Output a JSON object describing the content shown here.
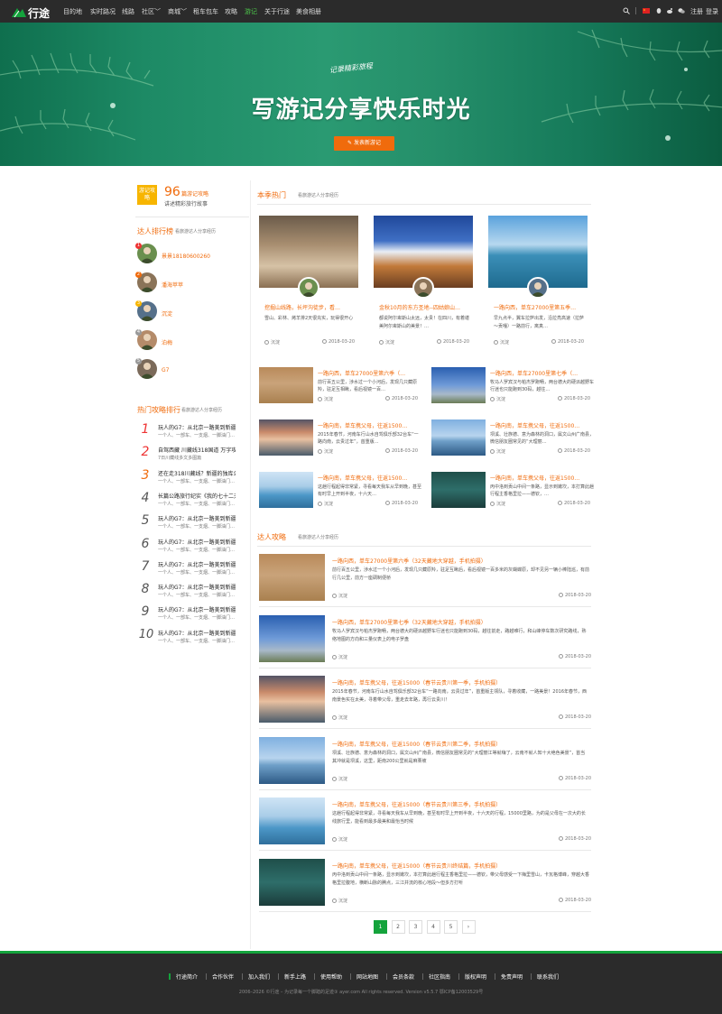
{
  "brand": {
    "logo_text": "行途",
    "accent": "#14a33c",
    "orange": "#f06b0c"
  },
  "nav": {
    "items": [
      "目的地",
      "实时路况",
      "线路",
      "社区",
      "商城",
      "租车包车",
      "攻略",
      "游记",
      "关于行途",
      "美食相册"
    ],
    "active": "游记",
    "register": "注册",
    "login": "登录",
    "icons": [
      "search-icon",
      "china-flag-icon",
      "qq-icon",
      "weibo-icon",
      "wechat-icon"
    ]
  },
  "hero": {
    "tagline": "记录精彩旅程",
    "title": "写游记分享快乐时光",
    "button": "发表新游记"
  },
  "sidebar": {
    "badge": "游记攻略",
    "count": "96",
    "count_label": "篇游记攻略",
    "desc": "讲述精彩旅行故事",
    "ranking": {
      "title": "达人排行榜",
      "sub": "看旅游达人分享经历",
      "users": [
        {
          "rank": "1",
          "name": "景景18180600260"
        },
        {
          "rank": "2",
          "name": "潘海苹苹"
        },
        {
          "rank": "3",
          "name": "沉淀"
        },
        {
          "rank": "4",
          "name": "泊梅"
        },
        {
          "rank": "5",
          "name": "G7"
        }
      ]
    },
    "hot": {
      "title": "热门攻略排行",
      "sub": "看旅游达人分享经历",
      "items": [
        {
          "num": "1",
          "title": "玩人的G7：从北京一路美到新疆，看…",
          "sub": "一个人、一部车、一支烟、一脚油门…"
        },
        {
          "num": "2",
          "title": "自驾西藏 川藏线318国道 万字攻略",
          "sub": "7日川藏线多文多图篇"
        },
        {
          "num": "3",
          "title": "还在走318川藏线？新疆的独库公路…",
          "sub": "一个人、一部车、一支烟、一脚油门…"
        },
        {
          "num": "4",
          "title": "长篇公路旅行纪实《我的七十二天》…",
          "sub": "一个人、一部车、一支烟、一脚油门…"
        },
        {
          "num": "5",
          "title": "玩人的G7：从北京一路美到新疆，看…",
          "sub": "一个人、一部车、一支烟、一脚油门…"
        },
        {
          "num": "6",
          "title": "玩人的G7：从北京一路美到新疆，看…",
          "sub": "一个人、一部车、一支烟、一脚油门…"
        },
        {
          "num": "7",
          "title": "玩人的G7：从北京一路美到新疆，看…",
          "sub": "一个人、一部车、一支烟、一脚油门…"
        },
        {
          "num": "8",
          "title": "玩人的G7：从北京一路美到新疆，看…",
          "sub": "一个人、一部车、一支烟、一脚油门…"
        },
        {
          "num": "9",
          "title": "玩人的G7：从北京一路美到新疆，看…",
          "sub": "一个人、一部车、一支烟、一脚油门…"
        },
        {
          "num": "10",
          "title": "玩人的G7：从北京一路美到新疆，看…",
          "sub": "一个人、一部车、一支烟、一脚油门…"
        }
      ]
    }
  },
  "season": {
    "title": "本季热门",
    "sub": "看旅游达人分享经历",
    "cards": [
      {
        "title": "挖掘山线路，长坪沟徒步，看…",
        "desc": "雪山、彩林、烤羊排2天很充实，玩得很开心",
        "user": "沉淀",
        "date": "2018-03-20"
      },
      {
        "title": "金秋10月的东方圣地--四姑娘山…",
        "desc": "都说阿尔卑斯山太远，太贵！在四川，有着堪美阿尔卑斯山的美景！…",
        "user": "沉淀",
        "date": "2018-03-20"
      },
      {
        "title": "一路向西，单车27000里第五季…",
        "desc": "早九点半，翼车拉萨出发，沿拉亮高速（拉萨～贡嘎）一路前行，离真…",
        "user": "沉淀",
        "date": "2018-03-20"
      }
    ],
    "mini": [
      {
        "title": "一路向西，单车27000里第六季（…",
        "desc": "前行百五公里，涉水过一个小河后，发现几只藏原羚，驻足互相瞅，看后视镜一百…",
        "user": "沉淀",
        "date": "2018-03-20"
      },
      {
        "title": "一路向西，单车27000里第七季（…",
        "desc": "牧马人罗宾汉与帕杰罗跑畅，两台德大的硬派越野车行迷也只能跑到30码，越往…",
        "user": "沉淀",
        "date": "2018-03-20"
      },
      {
        "title": "一路向南，单车携父母，往返1500…",
        "desc": "2015年春节，河南车行山水自驾俱乐部32台车“一路向南，云贵过年”，首重版…",
        "user": "沉淀",
        "date": "2018-03-20"
      },
      {
        "title": "一路向南，单车携父母，往返1500…",
        "desc": "坝溪、壮族德、意为森林的洞口，属文山州广南县，微信朋友圈常见的“大理丽…",
        "user": "沉淀",
        "date": "2018-03-20"
      },
      {
        "title": "一路向南，单车携父母，往返1500…",
        "desc": "这趟行程起得非常紧，寻看每天我车从早到晚，甚至有时早上开到半夜，十六天…",
        "user": "沉淀",
        "date": "2018-03-20"
      },
      {
        "title": "一路向南，单车携父母，往返1500…",
        "desc": "丙中洛到贡山中间一条路，显示到嫩坎，本打算此趟行程主香格里拉——德钦，…",
        "user": "沉淀",
        "date": "2018-03-20"
      }
    ]
  },
  "expert": {
    "title": "达人攻略",
    "sub": "看旅游达人分享经历",
    "items": [
      {
        "title": "一路向西，单车27000里第六季（32天藏地大穿越，手机拍摄）",
        "desc": "前行百五公里，涉水过一个小河后，发现几只藏原羚，驻足互瞅后，看后视镜一百多米的灰蝴蝶原，却不见另一辆小棒陆巡，有前行几公里，前方一座碉制便桥",
        "user": "沉淀",
        "date": "2018-03-20"
      },
      {
        "title": "一路向西，单车27000里第七季（32天藏地大穿越，手机拍摄）",
        "desc": "牧马人罗宾汉与帕杰罗跑畅，两台德大的硬派越野车行迷也只能跑到30码，越往前走，路越难行，和山峰停车数次研究路线，熟络地图的方向和三量仪表上的电子罗盘",
        "user": "沉淀",
        "date": "2018-03-20"
      },
      {
        "title": "一路向南，单车携父母，往返15000（春节云贵川第一季，手机拍摄）",
        "desc": "2015年春节，河南车行山水自驾俱乐部32台车“一路向南，云贵过年”，首重版主领队，寻着收藏，一路美景！2016年春节，西南景色实在太美，寻着带父母，重走去年路，再行云贵川！",
        "user": "沉淀",
        "date": "2018-03-20"
      },
      {
        "title": "一路向南，单车携父母，往返15000（春节云贵川第二季，手机拍摄）",
        "desc": "坝溪、壮族德、意为森林的洞口，属文山州广南县，微信朋友圈常见的“大理丽江等就嗨了，云南不就人知十大绝色美景”，首当其冲就是坝溪，这里，距南200公里就是麻栗坡",
        "user": "沉淀",
        "date": "2018-03-20"
      },
      {
        "title": "一路向南，单车携父母，往返15000（春节云贵川第三季，手机拍摄）",
        "desc": "这趟行程起得非常紧，寻看每天我车从早到晚，甚至有时早上开到半夜，十六天的行程，15000里路，为的是父母在一次大的长线旅行里，能看到最多最美和最怡当时候",
        "user": "沉淀",
        "date": "2018-03-20"
      },
      {
        "title": "一路向南，单车携父母，往返15000（春节云贵川终结篇，手机拍摄）",
        "desc": "丙中洛到贡山中间一条路，显示到嫩坎，本打算此趟行程主香格里拉——德钦，带父母感受一下梅里雪山，卡瓦格博峰，穿越大香格里拉腹地，横断山脉的腾点，三江并流的核心地段～但多方打听",
        "user": "沉淀",
        "date": "2018-03-20"
      }
    ]
  },
  "pagination": {
    "pages": [
      "1",
      "2",
      "3",
      "4",
      "5",
      "›"
    ],
    "current": "1"
  },
  "footer": {
    "links": [
      "行途简介",
      "合作伙伴",
      "加入我们",
      "新手上路",
      "使用帮助",
      "网站地图",
      "会员条款",
      "社区指南",
      "版权声明",
      "免责声明",
      "联系我们"
    ],
    "copyright": "2006–2026 ©行途 – 为记录每一个脚踏的足迹③ ayer.com All rights reserved. Version v5.5.7 鄂ICP备12003529号"
  }
}
